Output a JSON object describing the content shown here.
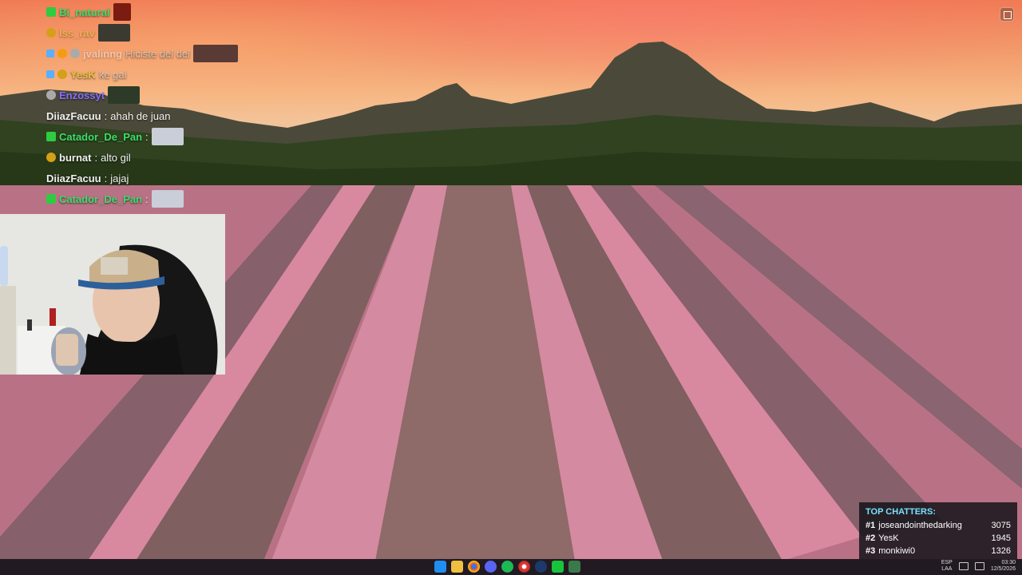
{
  "chat": {
    "messages": [
      {
        "user": "Bi_natural",
        "text": "",
        "user_color": "green",
        "badges": [
          "green"
        ],
        "emote": true
      },
      {
        "user": "lss_rav",
        "text": "",
        "user_color": "yellow",
        "badges": [
          "gold"
        ],
        "emote": true
      },
      {
        "user": "jvalinng",
        "text": "Hiciste del del",
        "user_color": "dim",
        "badges": [
          "blue",
          "orange",
          "grey"
        ],
        "emote": true
      },
      {
        "user": "YesK",
        "text": "ke gai",
        "user_color": "yellow",
        "badges": [
          "blue",
          "gold"
        ],
        "emote": false
      },
      {
        "user": "Enzossyt",
        "text": "",
        "user_color": "purple",
        "badges": [
          "grey"
        ],
        "emote": true
      },
      {
        "user": "DiiazFacuu",
        "text": "ahah de juan",
        "user_color": "white",
        "badges": [],
        "emote": false
      },
      {
        "user": "Catador_De_Pan",
        "text": "",
        "user_color": "green",
        "badges": [
          "green"
        ],
        "emote": true
      },
      {
        "user": "burnat",
        "text": "alto gil",
        "user_color": "white",
        "badges": [
          "gold"
        ],
        "emote": false
      },
      {
        "user": "DiiazFacuu",
        "text": "jajaj",
        "user_color": "white",
        "badges": [],
        "emote": false
      },
      {
        "user": "Catador_De_Pan",
        "text": "",
        "user_color": "green",
        "badges": [
          "green"
        ],
        "emote": true
      }
    ]
  },
  "top_chatters": {
    "title": "TOP CHATTERS:",
    "rows": [
      {
        "rank": "#1",
        "name": "joseandointhedarking",
        "count": "3075"
      },
      {
        "rank": "#2",
        "name": "YesK",
        "count": "1945"
      },
      {
        "rank": "#3",
        "name": "monkiwi0",
        "count": "1326"
      }
    ]
  },
  "taskbar": {
    "icons": [
      "windows-start-icon",
      "file-explorer-icon",
      "chrome-icon",
      "discord-icon",
      "spotify-icon",
      "chrome-alt-icon",
      "steam-icon",
      "obs-icon",
      "terminal-icon"
    ],
    "language": "ESP",
    "language_sub": "LAA",
    "time": "03:30",
    "date": "12/5/2026"
  },
  "colors": {
    "chatters_title": "#7ce0ff",
    "taskbar_bg": "#221a22"
  }
}
